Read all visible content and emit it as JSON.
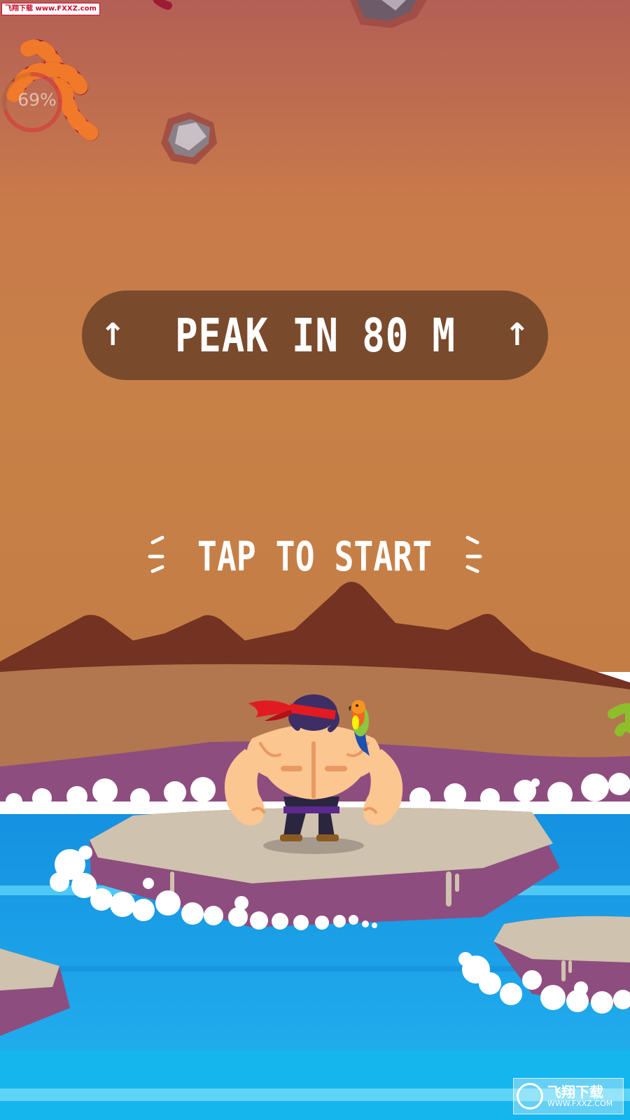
{
  "watermark_top": "飞翔下载 www.FXXZ.com",
  "progress": {
    "label": "69%",
    "value_percent": 69
  },
  "banner": {
    "text": "PEAK IN 80 M",
    "arrow_left": "↑",
    "arrow_right": "↑"
  },
  "prompt": {
    "text": "TAP TO START"
  },
  "watermark_bottom": {
    "cn": "飞翔下载",
    "url": "WWW.FXXZ.COM"
  },
  "colors": {
    "sky_top": "#b35f56",
    "sky_mid": "#c98049",
    "sky_low": "#c47d45",
    "mountains": "#733222",
    "hills": "#b3774f",
    "banner_bg": "#7a4a2d",
    "water": "#1d9fe6",
    "rock_top": "#cfc2ae",
    "rock_side": "#8e4d7f",
    "foam": "#ffffff",
    "bandana": "#e21b23",
    "skin": "#fcc690"
  },
  "icons": [
    "candy-cane-icon",
    "falling-rock-icon",
    "up-arrow-icon",
    "parrot-icon",
    "muscleman-character"
  ]
}
